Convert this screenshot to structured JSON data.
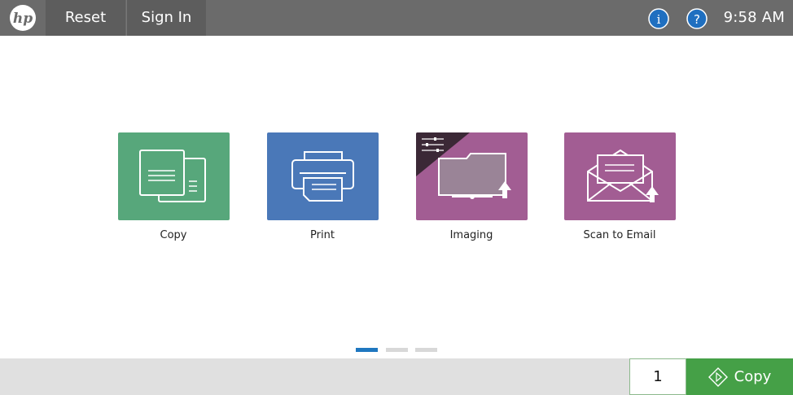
{
  "header": {
    "logo_icon": "hp-logo-icon",
    "reset_label": "Reset",
    "signin_label": "Sign In",
    "info_icon": "info-icon",
    "help_icon": "help-icon",
    "time": "9:58 AM"
  },
  "tiles": [
    {
      "label": "Copy",
      "icon": "copy-documents-icon",
      "color": "#57a77b"
    },
    {
      "label": "Print",
      "icon": "printer-icon",
      "color": "#4a78b8"
    },
    {
      "label": "Imaging",
      "icon": "folder-upload-icon",
      "color": "#a25d93",
      "badge_icon": "settings-sliders-icon"
    },
    {
      "label": "Scan to Email",
      "icon": "envelope-upload-icon",
      "color": "#a25d93"
    }
  ],
  "pager": {
    "pages": 3,
    "active": 1,
    "active_color": "#1f77c0",
    "inactive_color": "#d8d8d8"
  },
  "footer": {
    "copies_count": "1",
    "copy_button_label": "Copy",
    "copy_button_icon": "start-diamond-icon",
    "copy_button_color": "#45a047"
  },
  "colors": {
    "topbar": "#6b6b6b",
    "topbar_button": "#5d5d5d",
    "icon_circle": "#1f6fc0"
  }
}
